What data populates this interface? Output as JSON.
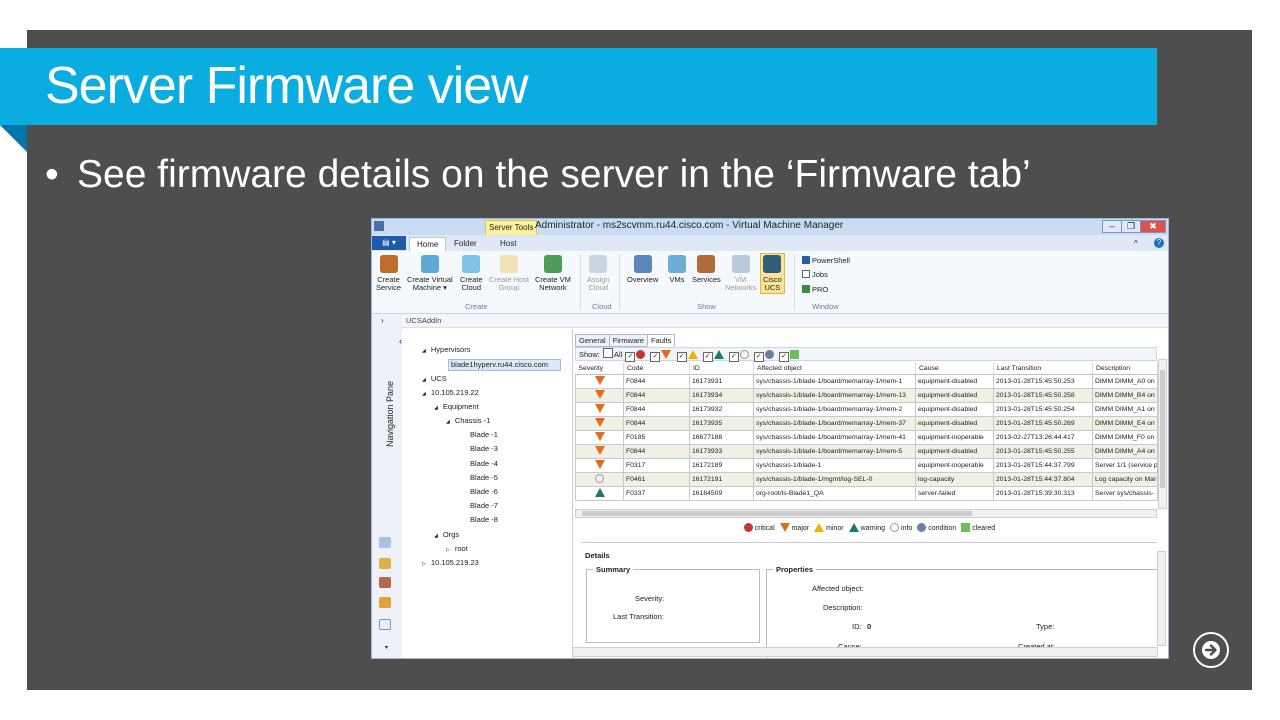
{
  "slide": {
    "title": "Server Firmware view",
    "bullet": "See firmware details on the server in the ‘Firmware tab’",
    "colors": {
      "slide_bg": "#4e4e4e",
      "title_bar": "#0aaddf",
      "text": "#ffffff"
    }
  },
  "window": {
    "title": "Administrator - ms2scvmm.ru44.cisco.com - Virtual Machine Manager",
    "context_tab": "Server Tools",
    "buttons": {
      "minimize": "–",
      "maximize": "❐",
      "close": "✖"
    }
  },
  "ribbon": {
    "file_label": "▤ ▾",
    "tabs": [
      "Home",
      "Folder",
      "Host"
    ],
    "help_icons": {
      "collapse": "^",
      "help": "?"
    },
    "groups": [
      {
        "label": "Create",
        "buttons": [
          {
            "line1": "Create",
            "line2": "Service",
            "icon": "create-service-icon",
            "disabled": false
          },
          {
            "line1": "Create Virtual",
            "line2": "Machine ▾",
            "icon": "create-vm-icon",
            "disabled": false
          },
          {
            "line1": "Create",
            "line2": "Cloud",
            "icon": "create-cloud-icon",
            "disabled": false
          },
          {
            "line1": "Create Host",
            "line2": "Group",
            "icon": "host-group-icon",
            "disabled": true
          },
          {
            "line1": "Create VM",
            "line2": "Network",
            "icon": "vm-network-icon",
            "disabled": false
          }
        ]
      },
      {
        "label": "Cloud",
        "buttons": [
          {
            "line1": "Assign",
            "line2": "Cloud",
            "icon": "assign-cloud-icon",
            "disabled": true
          }
        ]
      },
      {
        "label": "Show",
        "buttons": [
          {
            "line1": "Overview",
            "line2": "",
            "icon": "overview-icon",
            "disabled": false
          },
          {
            "line1": "VMs",
            "line2": "",
            "icon": "vms-icon",
            "disabled": false
          },
          {
            "line1": "Services",
            "line2": "",
            "icon": "services-icon",
            "disabled": false
          },
          {
            "line1": "VM",
            "line2": "Networks",
            "icon": "vm-networks-icon",
            "disabled": true
          },
          {
            "line1": "Cisco",
            "line2": "UCS",
            "icon": "cisco-ucs-icon",
            "disabled": false,
            "selected": true
          }
        ]
      },
      {
        "label": "Window",
        "items": [
          "PowerShell",
          "Jobs",
          "PRO"
        ]
      }
    ]
  },
  "nav": {
    "pane_label": "Navigation Pane",
    "breadcrumb": "UCSAddIn",
    "collapse": "‹",
    "tree": [
      {
        "label": "Hypervisors",
        "level": 0,
        "arrow": "◢"
      },
      {
        "label": "blade1hyperv.ru44.cisco.com",
        "level": 1,
        "selected": true
      },
      {
        "label": "UCS",
        "level": 0,
        "arrow": "◢"
      },
      {
        "label": "10.105.219.22",
        "level": 1,
        "arrow": "◢"
      },
      {
        "label": "Equipment",
        "level": 2,
        "arrow": "◢"
      },
      {
        "label": "Chassis -1",
        "level": 3,
        "arrow": "◢"
      },
      {
        "label": "Blade -1",
        "level": 4
      },
      {
        "label": "Blade -3",
        "level": 4
      },
      {
        "label": "Blade -4",
        "level": 4
      },
      {
        "label": "Blade -5",
        "level": 4
      },
      {
        "label": "Blade -6",
        "level": 4
      },
      {
        "label": "Blade -7",
        "level": 4
      },
      {
        "label": "Blade -8",
        "level": 4
      },
      {
        "label": "Orgs",
        "level": 2,
        "arrow": "◢"
      },
      {
        "label": "root",
        "level": 3,
        "arrow": "▷"
      },
      {
        "label": "10.105.219.23",
        "level": 0,
        "arrow": "▷"
      }
    ]
  },
  "panel": {
    "tabs": [
      "General",
      "Firmware",
      "Faults"
    ],
    "active_tab": "Faults",
    "show_label": "Show:",
    "show_all": "All",
    "columns": [
      "Severity",
      "Code",
      "ID",
      "Affected object",
      "Cause",
      "Last Transition",
      "Description"
    ],
    "rows": [
      {
        "sev": "major",
        "code": "F0844",
        "id": "16173931",
        "obj": "sys/chassis-1/blade-1/board/memarray-1/mem-1",
        "cause": "equipment-disabled",
        "time": "2013-01-28T15:45:50.253",
        "desc": "DIMM DIMM_A0 on"
      },
      {
        "sev": "major",
        "code": "F0844",
        "id": "16173934",
        "obj": "sys/chassis-1/blade-1/board/memarray-1/mem-13",
        "cause": "equipment-disabled",
        "time": "2013-01-28T15:45:50.258",
        "desc": "DIMM DIMM_B4 on"
      },
      {
        "sev": "major",
        "code": "F0844",
        "id": "16173932",
        "obj": "sys/chassis-1/blade-1/board/memarray-1/mem-2",
        "cause": "equipment-disabled",
        "time": "2013-01-28T15:45:50.254",
        "desc": "DIMM DIMM_A1 on"
      },
      {
        "sev": "major",
        "code": "F0844",
        "id": "16173935",
        "obj": "sys/chassis-1/blade-1/board/memarray-1/mem-37",
        "cause": "equipment-disabled",
        "time": "2013-01-28T15:45:50.269",
        "desc": "DIMM DIMM_E4 on"
      },
      {
        "sev": "major",
        "code": "F0185",
        "id": "16677188",
        "obj": "sys/chassis-1/blade-1/board/memarray-1/mem-41",
        "cause": "equipment-inoperable",
        "time": "2013-02-27T13:26:44.417",
        "desc": "DIMM DIMM_F0 on"
      },
      {
        "sev": "major",
        "code": "F0844",
        "id": "16173933",
        "obj": "sys/chassis-1/blade-1/board/memarray-1/mem-5",
        "cause": "equipment-disabled",
        "time": "2013-01-28T15:45:50.255",
        "desc": "DIMM DIMM_A4 on"
      },
      {
        "sev": "major",
        "code": "F0317",
        "id": "16172189",
        "obj": "sys/chassis-1/blade-1",
        "cause": "equipment-inoperable",
        "time": "2013-01-28T15:44:37.799",
        "desc": "Server 1/1 (service p"
      },
      {
        "sev": "info",
        "code": "F0461",
        "id": "16172191",
        "obj": "sys/chassis-1/blade-1/mgmt/log-SEL-0",
        "cause": "log-capacity",
        "time": "2013-01-28T15:44:37.804",
        "desc": "Log capacity on Mar"
      },
      {
        "sev": "warning",
        "code": "F0337",
        "id": "16164509",
        "obj": "org-root/ls-Blade1_QA",
        "cause": "server-failed",
        "time": "2013-01-28T15:39:30.313",
        "desc": "Server sys/chassis-"
      }
    ],
    "legend": [
      "critical",
      "major",
      "minor",
      "warning",
      "info",
      "condition",
      "cleared"
    ],
    "details": {
      "header": "Details",
      "summary_title": "Summary",
      "severity_label": "Severity:",
      "last_transition_label": "Last Transition:",
      "properties_title": "Properties",
      "affected_object_label": "Affected object:",
      "description_label": "Description:",
      "id_label": "ID:",
      "id_value": "0",
      "type_label": "Type:",
      "cause_label": "Cause:",
      "created_label": "Created at:"
    }
  }
}
